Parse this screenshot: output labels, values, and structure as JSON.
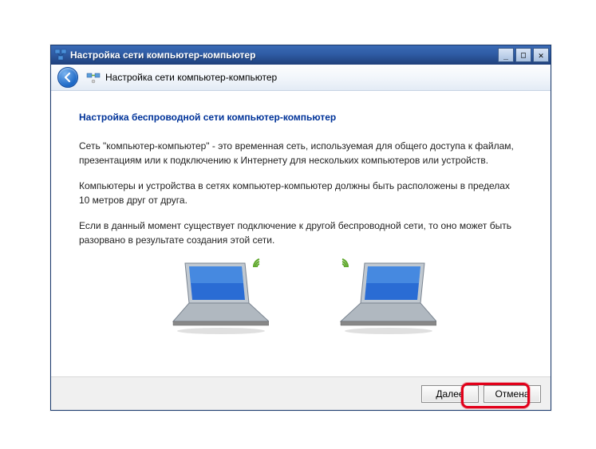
{
  "window": {
    "title": "Настройка сети компьютер-компьютер"
  },
  "navbar": {
    "title": "Настройка сети компьютер-компьютер"
  },
  "content": {
    "heading": "Настройка беспроводной сети компьютер-компьютер",
    "p1": "Сеть \"компьютер-компьютер\" - это временная сеть, используемая для общего доступа к файлам, презентациям или к подключению к Интернету для нескольких компьютеров или устройств.",
    "p2": "Компьютеры и устройства в сетях компьютер-компьютер должны быть расположены в пределах 10 метров друг от друга.",
    "p3": "Если в данный момент существует подключение к другой беспроводной сети, то оно может быть разорвано в результате создания этой сети."
  },
  "footer": {
    "next": "Далее",
    "cancel": "Отмена"
  },
  "winbuttons": {
    "min": "_",
    "max": "□",
    "close": "✕"
  }
}
